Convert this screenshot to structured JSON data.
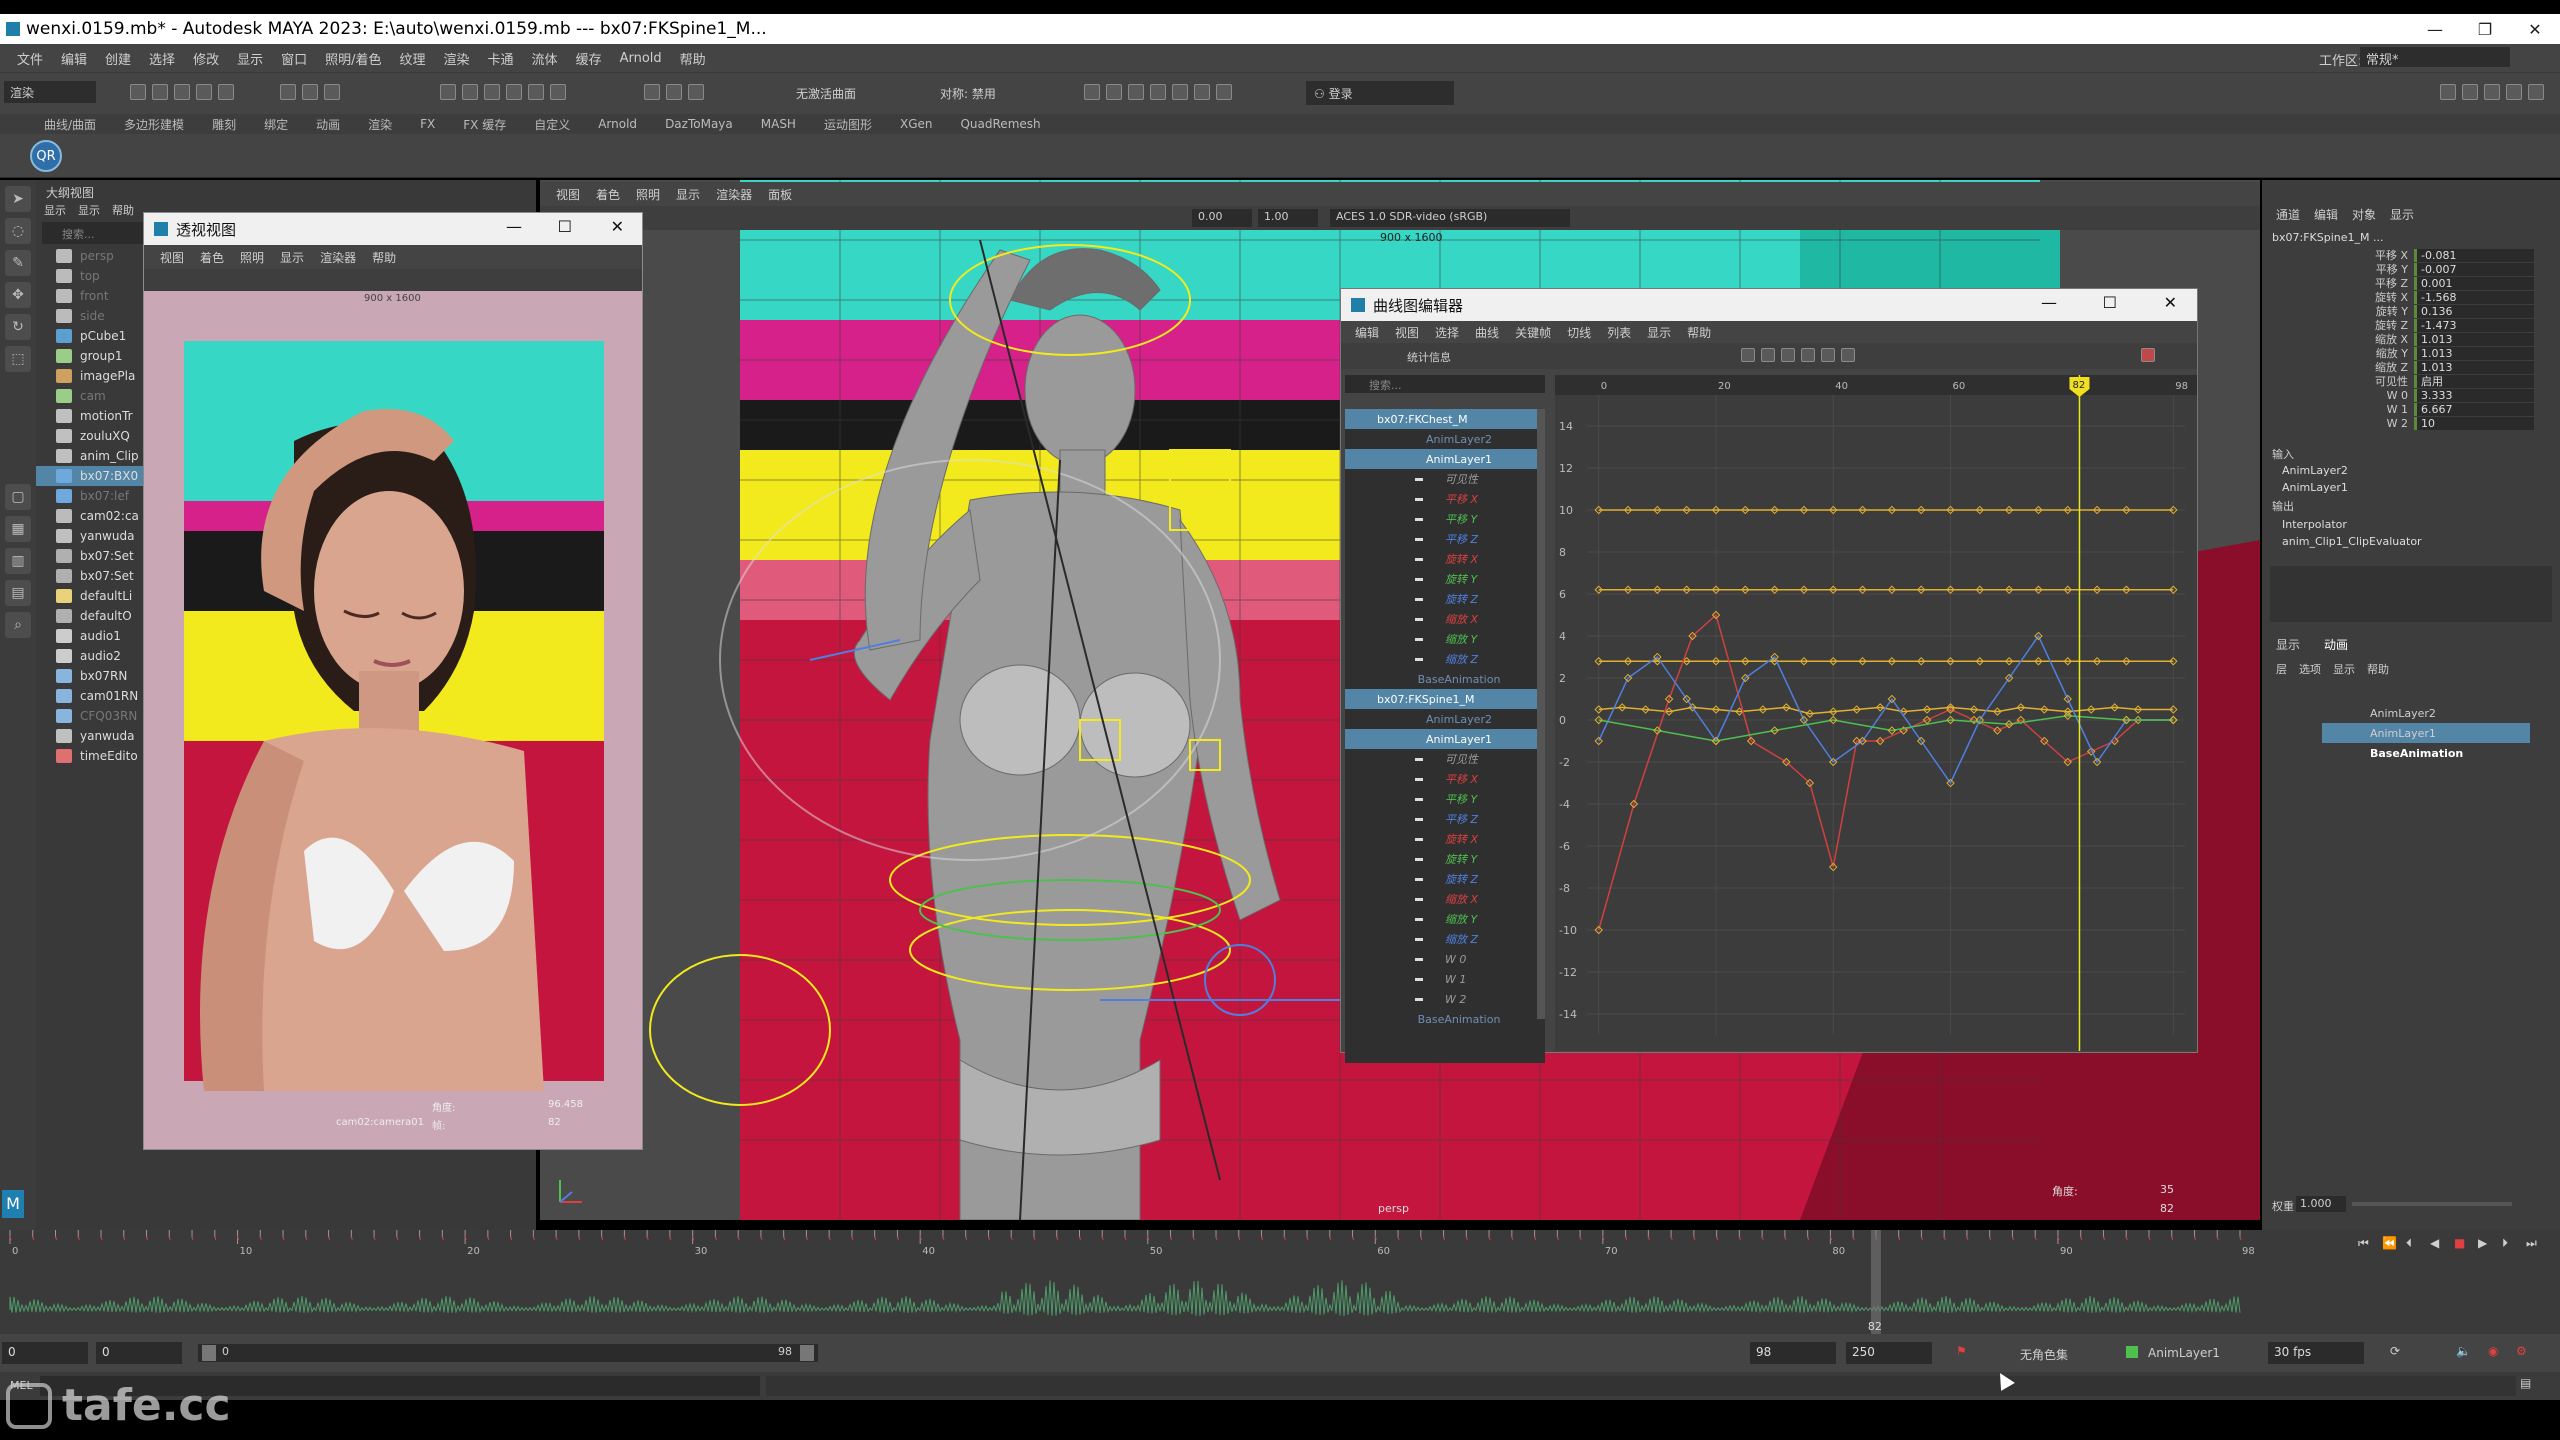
{
  "window": {
    "title": "wenxi.0159.mb* - Autodesk MAYA 2023: E:\\auto\\wenxi.0159.mb  ---  bx07:FKSpine1_M...",
    "workspace_label": "工作区:",
    "workspace_value": "常规*"
  },
  "menubar": [
    "文件",
    "编辑",
    "创建",
    "选择",
    "修改",
    "显示",
    "窗口",
    "照明/着色",
    "纹理",
    "渲染",
    "卡通",
    "流体",
    "缓存",
    "Arnold",
    "帮助"
  ],
  "statusline": {
    "mode": "渲染",
    "no_live_surface": "无激活曲面",
    "symmetry": "对称: 禁用",
    "login": "登录"
  },
  "shelf_tabs": [
    "曲线/曲面",
    "多边形建模",
    "雕刻",
    "绑定",
    "动画",
    "渲染",
    "FX",
    "FX 缓存",
    "自定义",
    "Arnold",
    "DazToMaya",
    "MASH",
    "运动图形",
    "XGen",
    "QuadRemesh"
  ],
  "outliner": {
    "title": "大纲视图",
    "menu": [
      "显示",
      "显示",
      "帮助"
    ],
    "search_placeholder": "搜索...",
    "items": [
      {
        "name": "persp",
        "kind": "camera",
        "dim": true
      },
      {
        "name": "top",
        "kind": "camera",
        "dim": true
      },
      {
        "name": "front",
        "kind": "camera",
        "dim": true
      },
      {
        "name": "side",
        "kind": "camera",
        "dim": true
      },
      {
        "name": "pCube1",
        "kind": "mesh",
        "dim": false
      },
      {
        "name": "group1",
        "kind": "group",
        "dim": false
      },
      {
        "name": "imagePla",
        "kind": "image",
        "dim": false
      },
      {
        "name": "cam",
        "kind": "group",
        "dim": true
      },
      {
        "name": "motionTr",
        "kind": "motion",
        "dim": false
      },
      {
        "name": "zouluXQ",
        "kind": "motion",
        "dim": false
      },
      {
        "name": "anim_Clip",
        "kind": "motion",
        "dim": false
      },
      {
        "name": "bx07:BX0",
        "kind": "rig",
        "dim": false,
        "selected": true
      },
      {
        "name": "bx07:lef",
        "kind": "rig",
        "dim": true
      },
      {
        "name": "cam02:ca",
        "kind": "camera",
        "dim": false
      },
      {
        "name": "yanwuda",
        "kind": "motion",
        "dim": false
      },
      {
        "name": "bx07:Set",
        "kind": "set",
        "dim": false
      },
      {
        "name": "bx07:Set",
        "kind": "set",
        "dim": false
      },
      {
        "name": "defaultLi",
        "kind": "light",
        "dim": false
      },
      {
        "name": "defaultO",
        "kind": "set",
        "dim": false
      },
      {
        "name": "audio1",
        "kind": "audio",
        "dim": false
      },
      {
        "name": "audio2",
        "kind": "audio",
        "dim": false
      },
      {
        "name": "bx07RN",
        "kind": "ref",
        "dim": false
      },
      {
        "name": "cam01RN",
        "kind": "ref",
        "dim": false
      },
      {
        "name": "CFQ03RN",
        "kind": "ref",
        "dim": true
      },
      {
        "name": "yanwuda",
        "kind": "motion",
        "dim": false
      },
      {
        "name": "timeEdito",
        "kind": "time",
        "dim": false
      }
    ]
  },
  "viewport": {
    "menu": [
      "视图",
      "着色",
      "照明",
      "显示",
      "渲染器",
      "面板"
    ],
    "exposure": "0.00",
    "gamma": "1.00",
    "color_space": "ACES 1.0 SDR-video (sRGB)",
    "resolution": "900 x 1600",
    "camera_name": "persp",
    "hud_frame_label": "角度:",
    "hud_frame_value": "35",
    "hud_fps_value": "82"
  },
  "persp_window": {
    "title": "透视视图",
    "menu": [
      "视图",
      "着色",
      "照明",
      "显示",
      "渲染器",
      "帮助"
    ],
    "resolution": "900 x 1600",
    "camera_name": "cam02:camera01",
    "hud_label_1": "角度:",
    "hud_value_1": "96.458",
    "hud_label_2": "帧:",
    "hud_value_2": "82"
  },
  "graph_editor": {
    "title": "曲线图编辑器",
    "menu": [
      "编辑",
      "视图",
      "选择",
      "曲线",
      "关键帧",
      "切线",
      "列表",
      "显示",
      "帮助"
    ],
    "stats_label": "统计信息",
    "search_placeholder": "搜索...",
    "current_frame": "82",
    "x_ticks": [
      "0",
      "20",
      "40",
      "60",
      "98"
    ],
    "y_ticks": [
      "14",
      "12",
      "10",
      "8",
      "6",
      "4",
      "2",
      "0",
      "-2",
      "-4",
      "-6",
      "-8",
      "-10",
      "-12",
      "-14"
    ],
    "list": [
      {
        "label": "bx07:FKChest_M",
        "type": "node"
      },
      {
        "label": "AnimLayer2",
        "type": "layer-dim"
      },
      {
        "label": "AnimLayer1",
        "type": "layer"
      },
      {
        "label": "可见性",
        "type": "attr",
        "color": "#9a9a9a"
      },
      {
        "label": "平移 X",
        "type": "attr",
        "color": "#d94040"
      },
      {
        "label": "平移 Y",
        "type": "attr",
        "color": "#4fbf4f"
      },
      {
        "label": "平移 Z",
        "type": "attr",
        "color": "#4f7fdf"
      },
      {
        "label": "旋转 X",
        "type": "attr",
        "color": "#d94040"
      },
      {
        "label": "旋转 Y",
        "type": "attr",
        "color": "#4fbf4f"
      },
      {
        "label": "旋转 Z",
        "type": "attr",
        "color": "#4f7fdf"
      },
      {
        "label": "缩放 X",
        "type": "attr",
        "color": "#d94040"
      },
      {
        "label": "缩放 Y",
        "type": "attr",
        "color": "#4fbf4f"
      },
      {
        "label": "缩放 Z",
        "type": "attr",
        "color": "#4f7fdf"
      },
      {
        "label": "BaseAnimation",
        "type": "layer-dim"
      },
      {
        "label": "bx07:FKSpine1_M",
        "type": "node"
      },
      {
        "label": "AnimLayer2",
        "type": "layer-dim"
      },
      {
        "label": "AnimLayer1",
        "type": "layer"
      },
      {
        "label": "可见性",
        "type": "attr",
        "color": "#9a9a9a"
      },
      {
        "label": "平移 X",
        "type": "attr",
        "color": "#d94040"
      },
      {
        "label": "平移 Y",
        "type": "attr",
        "color": "#4fbf4f"
      },
      {
        "label": "平移 Z",
        "type": "attr",
        "color": "#4f7fdf"
      },
      {
        "label": "旋转 X",
        "type": "attr",
        "color": "#d94040"
      },
      {
        "label": "旋转 Y",
        "type": "attr",
        "color": "#4fbf4f"
      },
      {
        "label": "旋转 Z",
        "type": "attr",
        "color": "#4f7fdf"
      },
      {
        "label": "缩放 X",
        "type": "attr",
        "color": "#d94040"
      },
      {
        "label": "缩放 Y",
        "type": "attr",
        "color": "#4fbf4f"
      },
      {
        "label": "缩放 Z",
        "type": "attr",
        "color": "#4f7fdf"
      },
      {
        "label": "W 0",
        "type": "attr",
        "color": "#9a9a9a"
      },
      {
        "label": "W 1",
        "type": "attr",
        "color": "#9a9a9a"
      },
      {
        "label": "W 2",
        "type": "attr",
        "color": "#9a9a9a"
      },
      {
        "label": "BaseAnimation",
        "type": "layer-dim"
      }
    ]
  },
  "chart_data": {
    "type": "line",
    "title": "",
    "xlim": [
      -2,
      100
    ],
    "ylim": [
      -15,
      15
    ],
    "current_frame": 82,
    "series": [
      {
        "color": "#e0b030",
        "x": [
          0,
          5,
          10,
          15,
          20,
          25,
          30,
          35,
          40,
          45,
          50,
          55,
          60,
          65,
          70,
          75,
          80,
          85,
          90,
          98
        ],
        "y": [
          10,
          10,
          10,
          10,
          10,
          10,
          10,
          10,
          10,
          10,
          10,
          10,
          10,
          10,
          10,
          10,
          10,
          10,
          10,
          10
        ]
      },
      {
        "color": "#e0b030",
        "x": [
          0,
          5,
          10,
          15,
          20,
          25,
          30,
          35,
          40,
          45,
          50,
          55,
          60,
          65,
          70,
          75,
          80,
          85,
          90,
          98
        ],
        "y": [
          6.2,
          6.2,
          6.2,
          6.2,
          6.2,
          6.2,
          6.2,
          6.2,
          6.2,
          6.2,
          6.2,
          6.2,
          6.2,
          6.2,
          6.2,
          6.2,
          6.2,
          6.2,
          6.2,
          6.2
        ]
      },
      {
        "color": "#e0b030",
        "x": [
          0,
          5,
          10,
          15,
          20,
          25,
          30,
          35,
          40,
          45,
          50,
          55,
          60,
          65,
          70,
          75,
          80,
          85,
          90,
          98
        ],
        "y": [
          2.8,
          2.8,
          2.8,
          2.8,
          2.8,
          2.8,
          2.8,
          2.8,
          2.8,
          2.8,
          2.8,
          2.8,
          2.8,
          2.8,
          2.8,
          2.8,
          2.8,
          2.8,
          2.8,
          2.8
        ]
      },
      {
        "color": "#e0b030",
        "x": [
          0,
          4,
          8,
          12,
          16,
          20,
          24,
          28,
          32,
          36,
          40,
          44,
          48,
          52,
          56,
          60,
          64,
          68,
          72,
          76,
          80,
          84,
          88,
          92,
          98
        ],
        "y": [
          0.5,
          0.6,
          0.5,
          0.4,
          0.6,
          0.5,
          0.4,
          0.5,
          0.6,
          0.3,
          0.4,
          0.5,
          0.6,
          0.4,
          0.5,
          0.6,
          0.5,
          0.4,
          0.6,
          0.5,
          0.4,
          0.5,
          0.6,
          0.5,
          0.5
        ]
      },
      {
        "color": "#d04040",
        "x": [
          0,
          6,
          12,
          16,
          20,
          26,
          32,
          36,
          40,
          44,
          48,
          52,
          56,
          60,
          64,
          68,
          72,
          76,
          80,
          84,
          88,
          92,
          98
        ],
        "y": [
          -10,
          -4,
          1,
          4,
          5,
          -1,
          -2,
          -3,
          -7,
          -1,
          -1,
          -0.5,
          0,
          0.5,
          0,
          -0.5,
          0,
          -1,
          -2,
          -1.5,
          -1,
          0,
          0
        ]
      },
      {
        "color": "#4f7fdf",
        "x": [
          0,
          5,
          10,
          15,
          20,
          25,
          30,
          35,
          40,
          45,
          50,
          55,
          60,
          65,
          70,
          75,
          80,
          85,
          90,
          98
        ],
        "y": [
          -1,
          2,
          3,
          1,
          -1,
          2,
          3,
          0,
          -2,
          -1,
          1,
          -1,
          -3,
          0,
          2,
          4,
          1,
          -2,
          0,
          0
        ]
      },
      {
        "color": "#4fbf4f",
        "x": [
          0,
          10,
          20,
          30,
          40,
          50,
          60,
          70,
          80,
          90,
          98
        ],
        "y": [
          0,
          -0.5,
          -1,
          -0.5,
          0,
          -0.5,
          0,
          -0.2,
          0.2,
          0,
          0
        ]
      }
    ]
  },
  "channel_box": {
    "tabs": [
      "通道",
      "编辑",
      "对象",
      "显示"
    ],
    "node": "bx07:FKSpine1_M ...",
    "channels": [
      {
        "label": "平移 X",
        "value": "-0.081"
      },
      {
        "label": "平移 Y",
        "value": "-0.007"
      },
      {
        "label": "平移 Z",
        "value": "0.001"
      },
      {
        "label": "旋转 X",
        "value": "-1.568"
      },
      {
        "label": "旋转 Y",
        "value": "0.136"
      },
      {
        "label": "旋转 Z",
        "value": "-1.473"
      },
      {
        "label": "缩放 X",
        "value": "1.013"
      },
      {
        "label": "缩放 Y",
        "value": "1.013"
      },
      {
        "label": "缩放 Z",
        "value": "1.013"
      },
      {
        "label": "可见性",
        "value": "启用"
      },
      {
        "label": "W 0",
        "value": "3.333"
      },
      {
        "label": "W 1",
        "value": "6.667"
      },
      {
        "label": "W 2",
        "value": "10"
      }
    ],
    "inputs_label": "输入",
    "inputs": [
      "AnimLayer2",
      "AnimLayer1"
    ],
    "outputs_label": "输出",
    "outputs": [
      "Interpolator",
      "anim_Clip1_ClipEvaluator"
    ]
  },
  "layer_editor": {
    "tabs": [
      "显示",
      "动画"
    ],
    "menu": [
      "层",
      "选项",
      "显示",
      "帮助"
    ],
    "layers": [
      "AnimLayer2",
      "AnimLayer1",
      "BaseAnimation"
    ],
    "weight_label": "权重",
    "weight_value": "1.000"
  },
  "timeline": {
    "current_frame": "82",
    "ticks": [
      "0",
      "10",
      "20",
      "30",
      "40",
      "50",
      "60",
      "70",
      "80",
      "90",
      "98"
    ]
  },
  "range_slider": {
    "start": "0",
    "anim_start": "0",
    "range_start": "0",
    "range_end": "98",
    "end": "98",
    "anim_end": "250",
    "character_set": "无角色集",
    "anim_layer": "AnimLayer1",
    "fps": "30 fps"
  },
  "cmdline": {
    "label": "MEL"
  },
  "watermark": "tafe.cc",
  "colors": {
    "accent": "#5285a6",
    "keyframe": "#e0b030",
    "selection": "#5285a6"
  }
}
